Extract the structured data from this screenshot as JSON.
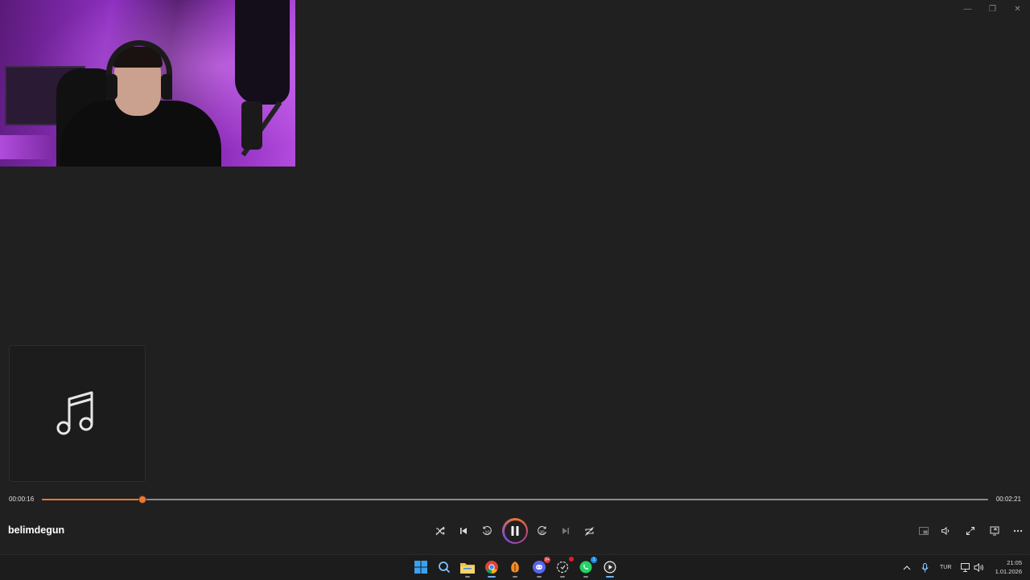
{
  "window": {
    "minimize_glyph": "—",
    "maximize_glyph": "❐",
    "close_glyph": "✕"
  },
  "player": {
    "song_title": "belimdegun",
    "elapsed": "00:00:16",
    "total": "00:02:21",
    "progress_fraction": 0.1064,
    "accent_color": "#f0772d"
  },
  "controls": {
    "shuffle_icon": "shuffle-icon",
    "previous_icon": "previous-track-icon",
    "rewind_label": "10",
    "play_pause_icon": "pause-icon",
    "forward_label": "30",
    "next_icon": "next-track-icon",
    "repeat_icon": "repeat-off-icon",
    "right_icons": [
      "miniplayer-icon",
      "volume-icon",
      "fullscreen-icon",
      "cast-icon",
      "more-icon"
    ]
  },
  "taskbar": {
    "apps": [
      "start",
      "search",
      "file-explorer",
      "chrome",
      "fl-studio",
      "discord",
      "app-notification",
      "whatsapp",
      "media-player"
    ],
    "discord_badge": "9+",
    "whatsapp_badge": "1",
    "language": "TUR",
    "time": "21:05",
    "date": "1.01.2026"
  }
}
